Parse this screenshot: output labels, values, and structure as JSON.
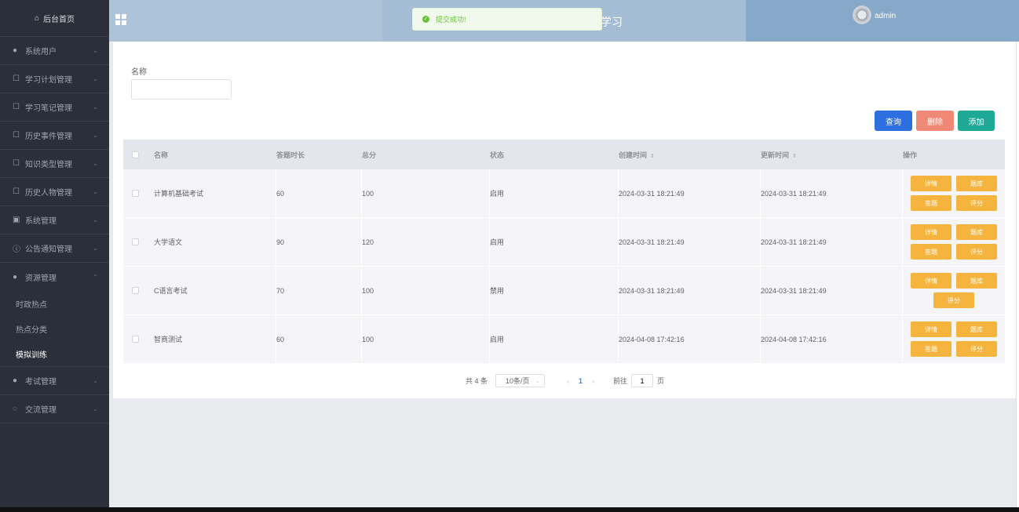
{
  "sidebar": {
    "home": "后台首页",
    "items": [
      {
        "label": "系统用户",
        "icon": "user-icon"
      },
      {
        "label": "学习计划管理",
        "icon": "doc-icon"
      },
      {
        "label": "学习笔记管理",
        "icon": "doc-icon"
      },
      {
        "label": "历史事件管理",
        "icon": "doc-icon"
      },
      {
        "label": "知识类型管理",
        "icon": "doc-icon"
      },
      {
        "label": "历史人物管理",
        "icon": "doc-icon"
      },
      {
        "label": "系统管理",
        "icon": "image-icon"
      },
      {
        "label": "公告通知管理",
        "icon": "info-icon"
      },
      {
        "label": "资源管理",
        "icon": "location-icon"
      }
    ],
    "sub_items": [
      "时政热点",
      "热点分类",
      "模拟训练"
    ],
    "bottom_items": [
      {
        "label": "考试管理",
        "icon": "location-icon"
      },
      {
        "label": "交流管理",
        "icon": "chat-icon"
      }
    ]
  },
  "header": {
    "title": "学习",
    "user": "admin"
  },
  "toast": {
    "message": "提交成功!"
  },
  "search": {
    "label": "名称",
    "value": ""
  },
  "actions": {
    "search": "查询",
    "delete": "删除",
    "add": "添加"
  },
  "table": {
    "headers": {
      "name": "名称",
      "duration": "答题时长",
      "score": "总分",
      "status": "状态",
      "created": "创建时间",
      "updated": "更新时间",
      "ops": "操作"
    },
    "op_labels": {
      "detail": "详情",
      "questions": "题库",
      "answer": "答题",
      "grade": "评分"
    },
    "rows": [
      {
        "name": "计算机基础考试",
        "duration": "60",
        "score": "100",
        "status": "启用",
        "created": "2024-03-31 18:21:49",
        "updated": "2024-03-31 18:21:49"
      },
      {
        "name": "大学语文",
        "duration": "90",
        "score": "120",
        "status": "启用",
        "created": "2024-03-31 18:21:49",
        "updated": "2024-03-31 18:21:49"
      },
      {
        "name": "C语言考试",
        "duration": "70",
        "score": "100",
        "status": "禁用",
        "created": "2024-03-31 18:21:49",
        "updated": "2024-03-31 18:21:49"
      },
      {
        "name": "智商测试",
        "duration": "60",
        "score": "100",
        "status": "启用",
        "created": "2024-04-08 17:42:16",
        "updated": "2024-04-08 17:42:16"
      }
    ]
  },
  "pagination": {
    "total": "共 4 条",
    "page_size": "10条/页",
    "current": "1",
    "goto_prefix": "前往",
    "goto_value": "1",
    "goto_suffix": "页"
  }
}
